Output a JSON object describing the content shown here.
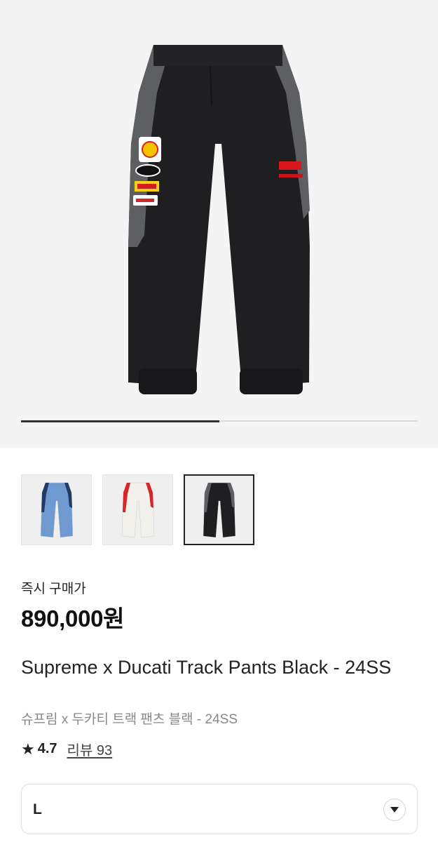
{
  "gallery": {
    "main_image": "black-track-pants-photo",
    "progress": 0.5,
    "thumbnails": [
      {
        "name": "blue-track-pants-thumbnail",
        "body_color": "#6e9ad0",
        "accent_color": "#243a66",
        "selected": false
      },
      {
        "name": "white-track-pants-thumbnail",
        "body_color": "#f2f0ea",
        "accent_color": "#d6262a",
        "selected": false
      },
      {
        "name": "black-track-pants-thumbnail",
        "body_color": "#1f1f21",
        "accent_color": "#5d5f63",
        "selected": true
      }
    ]
  },
  "product": {
    "buy_now_label": "즉시 구매가",
    "price": "890,000원",
    "title": "Supreme x Ducati Track Pants Black - 24SS",
    "subtitle": "슈프림 x 두카티 트랙 팬츠 블랙 - 24SS",
    "rating": "4.7",
    "review_label": "리뷰 93"
  },
  "size_selector": {
    "value": "L",
    "icon": "chevron-down-icon"
  },
  "colors": {
    "pants_black": "#1f1f21",
    "panel_gray": "#5d5f63",
    "hero_background": "#f4f4f4"
  }
}
